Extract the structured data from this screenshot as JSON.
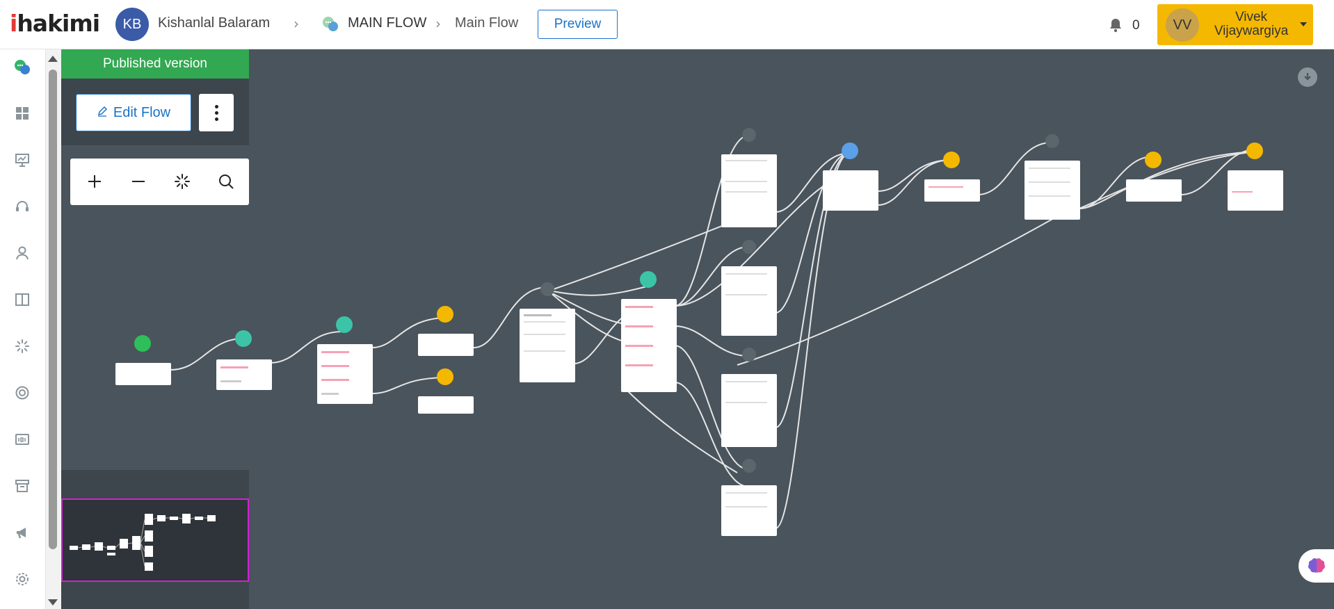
{
  "header": {
    "logo": {
      "prefix": "i",
      "rest": "hakimi"
    },
    "account_initials": "KB",
    "account_name": "Kishanlal Balaram",
    "flow_group": "MAIN FLOW",
    "flow_name": "Main Flow",
    "preview_label": "Preview",
    "notification_count": "0",
    "user_initials": "VV",
    "user_name": "Vivek Vijaywargiya"
  },
  "sidebar": {
    "items": [
      {
        "icon": "chat-bubbles-icon"
      },
      {
        "icon": "dashboard-icon"
      },
      {
        "icon": "presentation-icon"
      },
      {
        "icon": "headset-icon"
      },
      {
        "icon": "user-icon"
      },
      {
        "icon": "book-icon"
      },
      {
        "icon": "loader-icon"
      },
      {
        "icon": "lifebuoy-icon"
      },
      {
        "icon": "id-card-icon"
      },
      {
        "icon": "archive-icon"
      },
      {
        "icon": "megaphone-icon"
      },
      {
        "icon": "settings-icon"
      }
    ]
  },
  "flow_panel": {
    "banner": "Published version",
    "edit_label": "Edit Flow"
  },
  "colors": {
    "canvas": "#4a545c",
    "published": "#32a852",
    "accent": "#1a73c8",
    "user_button": "#f5b800",
    "minimap_frame": "#d61fd6"
  }
}
